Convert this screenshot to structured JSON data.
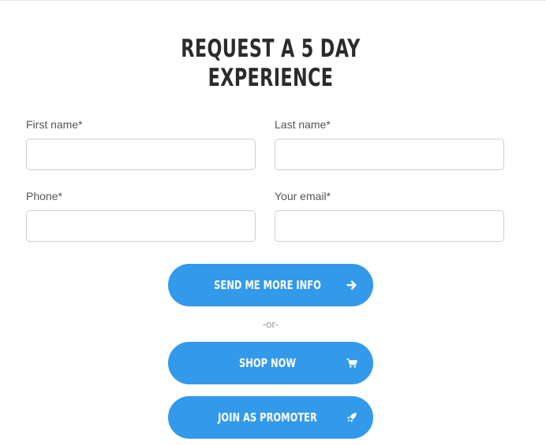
{
  "form": {
    "title_line1": "REQUEST A 5 DAY",
    "title_line2": "EXPERIENCE",
    "fields": {
      "first_name": {
        "label": "First name*",
        "value": ""
      },
      "last_name": {
        "label": "Last name*",
        "value": ""
      },
      "phone": {
        "label": "Phone*",
        "value": ""
      },
      "email": {
        "label": "Your email*",
        "value": ""
      }
    },
    "buttons": {
      "send_info": {
        "label": "SEND ME MORE INFO",
        "icon": "arrow-right-icon"
      },
      "shop_now": {
        "label": "SHOP NOW",
        "icon": "shopping-cart-icon"
      },
      "join_promoter": {
        "label": "JOIN AS PROMOTER",
        "icon": "rocket-icon"
      }
    },
    "separator": "-or-"
  },
  "colors": {
    "accent": "#3399ea",
    "title": "#2b2b2b",
    "label": "#555555",
    "input_border": "#cfcfcf",
    "muted": "#999999"
  }
}
